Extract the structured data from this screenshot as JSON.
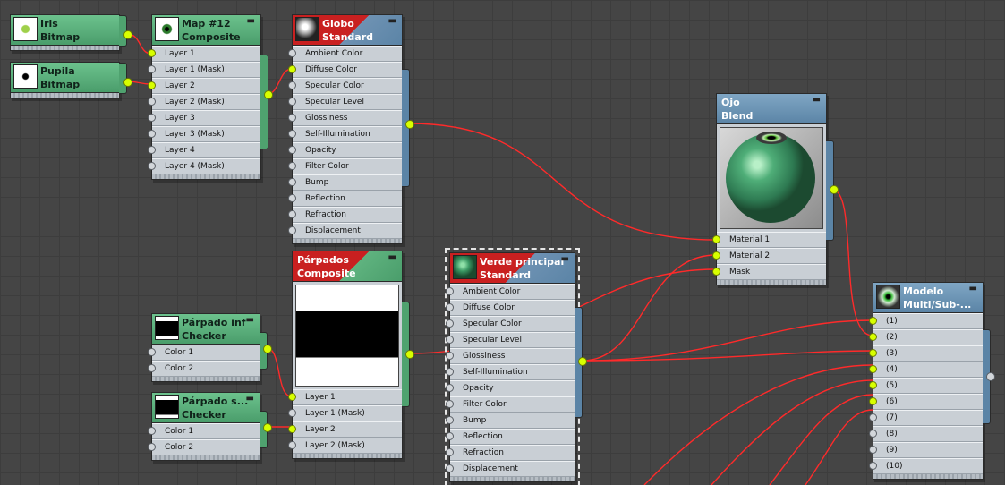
{
  "nodes": {
    "iris": {
      "name": "Iris",
      "type": "Bitmap"
    },
    "pupila": {
      "name": "Pupila",
      "type": "Bitmap"
    },
    "map12": {
      "name": "Map #12",
      "type": "Composite",
      "slots": [
        "Layer 1",
        "Layer 1 (Mask)",
        "Layer 2",
        "Layer 2 (Mask)",
        "Layer 3",
        "Layer 3 (Mask)",
        "Layer 4",
        "Layer 4 (Mask)"
      ]
    },
    "globo": {
      "name": "Globo",
      "type": "Standard",
      "slots": [
        "Ambient Color",
        "Diffuse Color",
        "Specular Color",
        "Specular Level",
        "Glossiness",
        "Self-Illumination",
        "Opacity",
        "Filter Color",
        "Bump",
        "Reflection",
        "Refraction",
        "Displacement"
      ]
    },
    "ojo": {
      "name": "Ojo",
      "type": "Blend",
      "slots": [
        "Material 1",
        "Material 2",
        "Mask"
      ]
    },
    "parpados": {
      "name": "Párpados",
      "type": "Composite",
      "slots": [
        "Layer 1",
        "Layer 1 (Mask)",
        "Layer 2",
        "Layer 2 (Mask)"
      ]
    },
    "parpado_inf": {
      "name": "Párpado inf",
      "type": "Checker",
      "slots": [
        "Color 1",
        "Color 2"
      ]
    },
    "parpado_sup": {
      "name": "Párpado s...",
      "type": "Checker",
      "slots": [
        "Color 1",
        "Color 2"
      ]
    },
    "verde": {
      "name": "Verde principal",
      "type": "Standard",
      "slots": [
        "Ambient Color",
        "Diffuse Color",
        "Specular Color",
        "Specular Level",
        "Glossiness",
        "Self-Illumination",
        "Opacity",
        "Filter Color",
        "Bump",
        "Reflection",
        "Refraction",
        "Displacement"
      ]
    },
    "modelo": {
      "name": "Modelo",
      "type": "Multi/Sub-...",
      "slots": [
        "(1)",
        "(2)",
        "(3)",
        "(4)",
        "(5)",
        "(6)",
        "(7)",
        "(8)",
        "(9)",
        "(10)"
      ]
    }
  },
  "colors": {
    "wire": "#ff2a2a",
    "socket_active": "#d8ff00",
    "map_header": "#4a9d6b",
    "material_header": "#5b84a6",
    "background": "#454545"
  }
}
